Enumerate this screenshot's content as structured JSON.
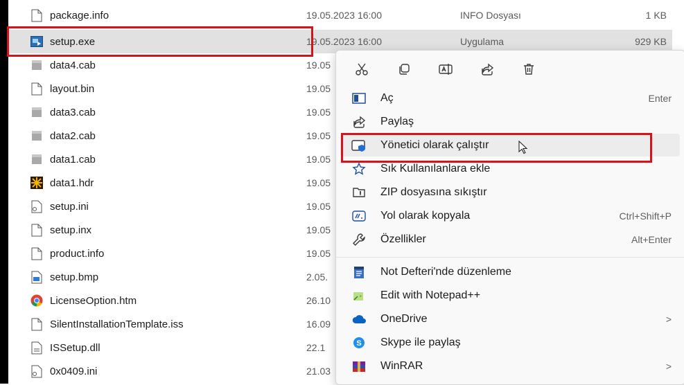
{
  "files": [
    {
      "name": "package.info",
      "date": "19.05.2023 16:00",
      "type": "INFO Dosyası",
      "size": "1 KB",
      "icon": "file-icon"
    },
    {
      "name": "setup.exe",
      "date": "19.05.2023 16:00",
      "type": "Uygulama",
      "size": "929 KB",
      "icon": "setup-app-icon",
      "selected": true
    },
    {
      "name": "data4.cab",
      "date": "19.05",
      "icon": "cab-icon"
    },
    {
      "name": "layout.bin",
      "date": "19.05",
      "icon": "file-icon"
    },
    {
      "name": "data3.cab",
      "date": "19.05",
      "icon": "cab-icon"
    },
    {
      "name": "data2.cab",
      "date": "19.05",
      "icon": "cab-icon"
    },
    {
      "name": "data1.cab",
      "date": "19.05",
      "icon": "cab-icon"
    },
    {
      "name": "data1.hdr",
      "date": "19.05",
      "icon": "hdr-icon"
    },
    {
      "name": "setup.ini",
      "date": "19.05",
      "icon": "ini-icon"
    },
    {
      "name": "setup.inx",
      "date": "19.05",
      "icon": "file-icon"
    },
    {
      "name": "product.info",
      "date": "19.05",
      "icon": "file-icon"
    },
    {
      "name": "setup.bmp",
      "date": "2.05.",
      "icon": "bmp-icon"
    },
    {
      "name": "LicenseOption.htm",
      "date": "26.10",
      "icon": "chrome-icon"
    },
    {
      "name": "SilentInstallationTemplate.iss",
      "date": "16.09",
      "icon": "file-icon"
    },
    {
      "name": "ISSetup.dll",
      "date": "22.1",
      "icon": "dll-icon"
    },
    {
      "name": "0x0409.ini",
      "date": "21.03",
      "icon": "ini-icon"
    }
  ],
  "context_menu": {
    "toolbar": [
      {
        "name": "cut-icon"
      },
      {
        "name": "copy-icon"
      },
      {
        "name": "rename-icon"
      },
      {
        "name": "share-icon"
      },
      {
        "name": "delete-icon"
      }
    ],
    "items": [
      {
        "label": "Aç",
        "shortcut": "Enter",
        "icon": "open-icon"
      },
      {
        "label": "Paylaş",
        "shortcut": "",
        "icon": "share-icon"
      },
      {
        "label": "Yönetici olarak çalıştır",
        "shortcut": "",
        "icon": "run-as-admin-icon",
        "highlighted": true
      },
      {
        "label": "Sık Kullanılanlara ekle",
        "shortcut": "",
        "icon": "star-icon"
      },
      {
        "label": "ZIP dosyasına sıkıştır",
        "shortcut": "",
        "icon": "zip-icon"
      },
      {
        "label": "Yol olarak kopyala",
        "shortcut": "Ctrl+Shift+P",
        "icon": "copy-path-icon"
      },
      {
        "label": "Özellikler",
        "shortcut": "Alt+Enter",
        "icon": "properties-icon"
      },
      {
        "label": "Not Defteri'nde düzenleme",
        "shortcut": "",
        "icon": "notepad-icon"
      },
      {
        "label": "Edit with Notepad++",
        "shortcut": "",
        "icon": "notepadpp-icon"
      },
      {
        "label": "OneDrive",
        "shortcut": "",
        "icon": "onedrive-icon",
        "submenu": true
      },
      {
        "label": "Skype ile paylaş",
        "shortcut": "",
        "icon": "skype-icon"
      },
      {
        "label": "WinRAR",
        "shortcut": "",
        "icon": "winrar-icon",
        "submenu": true
      }
    ],
    "submenu_arrow": ">"
  },
  "colors": {
    "highlight_border": "#d4141c",
    "selected_row": "#e1e1e1"
  }
}
